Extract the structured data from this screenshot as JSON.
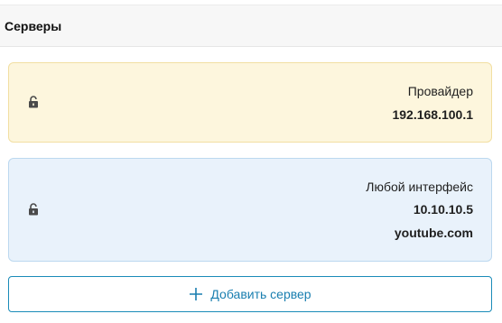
{
  "header": {
    "title": "Серверы"
  },
  "servers": [
    {
      "icon": "lock-icon",
      "lines": [
        "Провайдер",
        "192.168.100.1"
      ]
    },
    {
      "icon": "lock-icon",
      "lines": [
        "Любой интерфейс",
        "10.10.10.5",
        "youtube.com"
      ]
    }
  ],
  "add_button": {
    "icon": "plus-icon",
    "label": "Добавить сервер"
  },
  "colors": {
    "card_provider_bg": "#fdf6dd",
    "card_provider_border": "#f2dfa2",
    "card_any_bg": "#e9f2fb",
    "card_any_border": "#bcd8ef",
    "accent": "#1a7fb0"
  }
}
